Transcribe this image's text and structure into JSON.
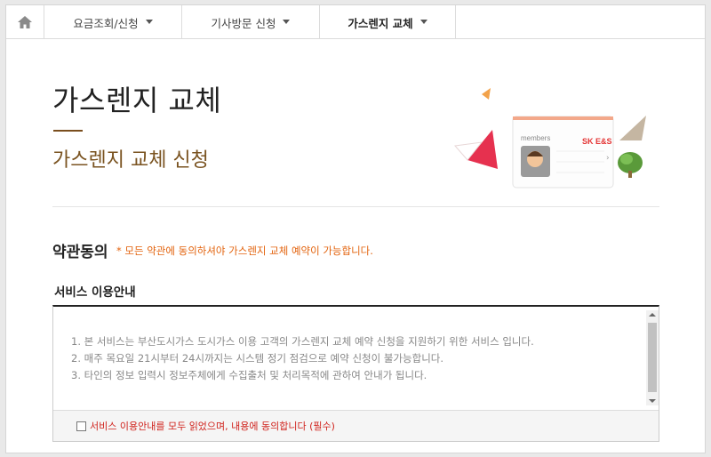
{
  "nav": {
    "home_icon": "home-icon",
    "tabs": [
      {
        "label": "요금조회/신청"
      },
      {
        "label": "기사방문 신청"
      },
      {
        "label": "가스렌지 교체",
        "active": true
      }
    ]
  },
  "header": {
    "title": "가스렌지 교체",
    "subtitle": "가스렌지 교체 신청",
    "banner": {
      "card_label": "members",
      "brand": "SK E&S"
    }
  },
  "agreement": {
    "title": "약관동의",
    "note": "* 모든 약관에 동의하셔야 가스렌지 교체 예약이 가능합니다.",
    "service_title": "서비스 이용안내",
    "lines": [
      "1. 본 서비스는 부산도시가스 도시가스 이용 고객의 가스렌지 교체 예약 신청을 지원하기 위한 서비스 입니다.",
      "2. 매주 목요일 21시부터 24시까지는 시스템 정기 점검으로 예약 신청이 불가능합니다.",
      "3. 타인의 정보 입력시 정보주체에게 수집출처 및 처리목적에 관하여 안내가 됩니다."
    ],
    "checkbox_label": "서비스 이용안내를 모두 읽었으며, 내용에 동의합니다 (필수)"
  },
  "colors": {
    "accent_brown": "#7a5320",
    "note_orange": "#e3640f",
    "check_red": "#d0221c"
  }
}
